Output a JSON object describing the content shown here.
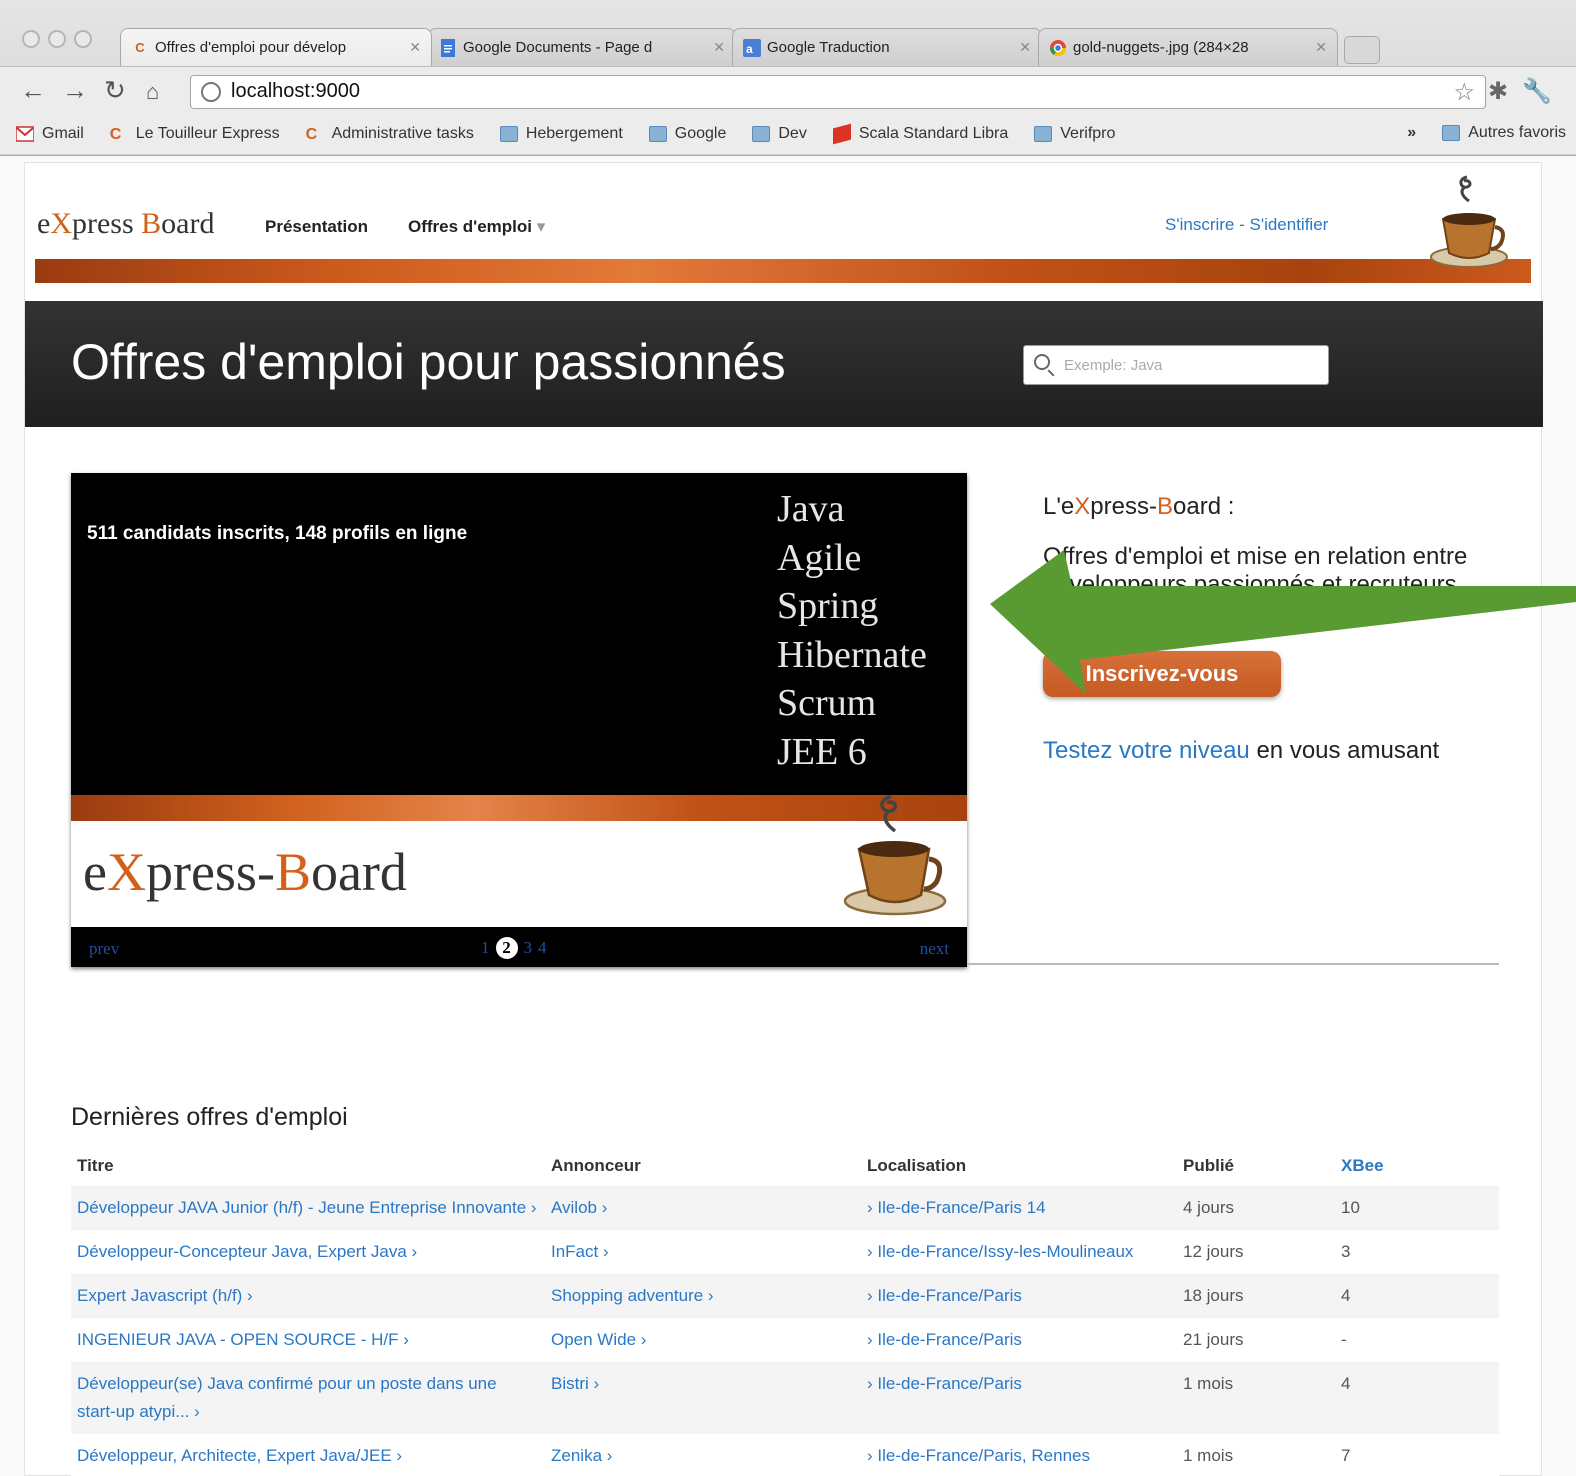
{
  "browser": {
    "tabs": [
      {
        "title": "Offres d'emploi pour dévelop",
        "active": true,
        "icon": "c-logo-icon"
      },
      {
        "title": "Google Documents - Page d",
        "active": false,
        "icon": "docs-icon"
      },
      {
        "title": "Google Traduction",
        "active": false,
        "icon": "translate-icon"
      },
      {
        "title": "gold-nuggets-.jpg (284×28",
        "active": false,
        "icon": "chrome-icon"
      }
    ],
    "url": "localhost:9000",
    "bookmarks": [
      {
        "label": "Gmail",
        "icon": "gmail-icon"
      },
      {
        "label": "Le Touilleur Express",
        "icon": "c-logo-icon"
      },
      {
        "label": "Administrative tasks",
        "icon": "c-logo-icon"
      },
      {
        "label": "Hebergement",
        "icon": "folder-icon"
      },
      {
        "label": "Google",
        "icon": "folder-icon"
      },
      {
        "label": "Dev",
        "icon": "folder-icon"
      },
      {
        "label": "Scala Standard Libra",
        "icon": "scala-icon"
      },
      {
        "label": "Verifpro",
        "icon": "folder-icon"
      }
    ],
    "bookmarks_more": "»",
    "other_bookmarks": "Autres favoris"
  },
  "site": {
    "brand_parts": [
      "e",
      "X",
      "press ",
      "B",
      "oard"
    ],
    "nav": {
      "presentation": "Présentation",
      "offres": "Offres d'emploi"
    },
    "auth": {
      "signup": "S'inscrire",
      "separator": " - ",
      "login": "S'identifier"
    },
    "hero_title": "Offres d'emploi pour passionnés",
    "search_placeholder": "Exemple: Java"
  },
  "slideshow": {
    "stats": "511 candidats inscrits, 148 profils en ligne",
    "skills": [
      "Java",
      "Agile",
      "Spring",
      "Hibernate",
      "Scrum",
      "JEE 6"
    ],
    "logo_parts": [
      "e",
      "X",
      "press-",
      "B",
      "oard"
    ],
    "prev": "prev",
    "next": "next",
    "pages": [
      "1",
      "2",
      "3",
      "4"
    ],
    "current_page": "2"
  },
  "info": {
    "heading_parts": [
      "L'e",
      "X",
      "press-",
      "B",
      "oard :"
    ],
    "description": "Offres d'emploi et mise en relation entre développeurs passionnés et recruteurs.",
    "cta": "Inscrivez-vous",
    "testez_link": "Testez votre niveau",
    "testez_rest": " en vous amusant"
  },
  "annotation": {
    "arrow_color": "#5a9a32"
  },
  "jobs": {
    "title": "Dernières offres d'emploi",
    "headers": [
      "Titre",
      "Annonceur",
      "Localisation",
      "Publié",
      "XBee"
    ],
    "rows": [
      {
        "titre": "Développeur JAVA Junior (h/f) - Jeune Entreprise Innovante ›",
        "annonceur": "Avilob ›",
        "localisation": "› Ile-de-France/Paris 14",
        "publie": "4 jours",
        "xbee": "10"
      },
      {
        "titre": "Développeur-Concepteur Java, Expert Java ›",
        "annonceur": "InFact ›",
        "localisation": "› Ile-de-France/Issy-les-Moulineaux",
        "publie": "12 jours",
        "xbee": "3"
      },
      {
        "titre": "Expert Javascript (h/f) ›",
        "annonceur": "Shopping adventure ›",
        "localisation": "› Ile-de-France/Paris",
        "publie": "18 jours",
        "xbee": "4"
      },
      {
        "titre": "INGENIEUR JAVA - OPEN SOURCE - H/F ›",
        "annonceur": "Open Wide ›",
        "localisation": "› Ile-de-France/Paris",
        "publie": "21 jours",
        "xbee": "-"
      },
      {
        "titre": "Développeur(se) Java confirmé pour un poste dans une start-up atypi... ›",
        "annonceur": "Bistri ›",
        "localisation": "› Ile-de-France/Paris",
        "publie": "1 mois",
        "xbee": "4"
      },
      {
        "titre": "Développeur, Architecte, Expert Java/JEE ›",
        "annonceur": "Zenika ›",
        "localisation": "› Ile-de-France/Paris, Rennes",
        "publie": "1 mois",
        "xbee": "7"
      }
    ]
  },
  "colors": {
    "accent": "#d35f1b",
    "link": "#2a78c5",
    "hero_bg": "#262626"
  }
}
